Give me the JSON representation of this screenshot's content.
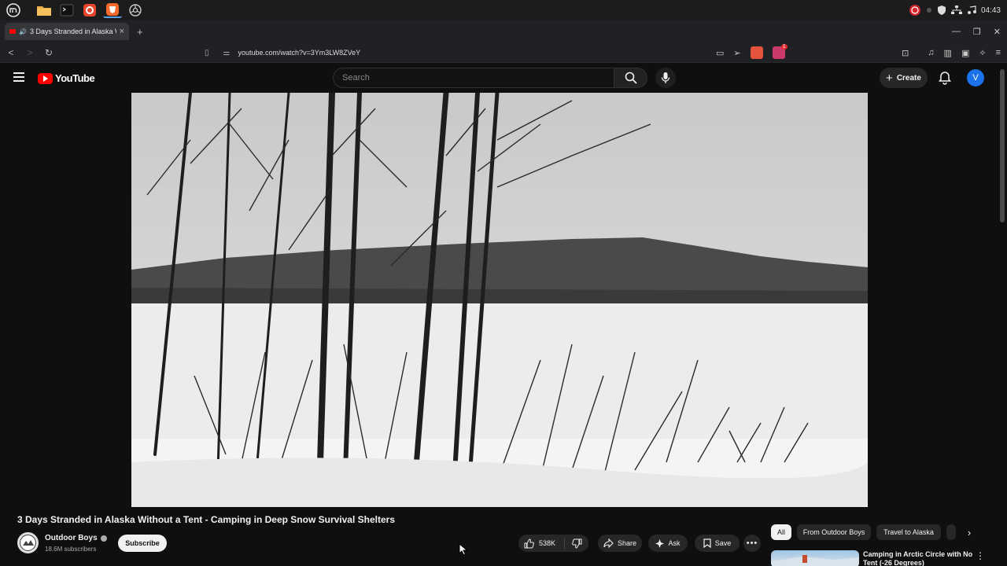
{
  "taskbar": {
    "apps": [
      "mint-menu-icon",
      "files-icon",
      "terminal-icon",
      "firefox-icon",
      "brave-icon",
      "chromium-icon"
    ],
    "clock": "04:43"
  },
  "browser": {
    "tab_title": "3 Days Stranded in Alaska W",
    "url": "youtube.com/watch?v=3Ym3LW8ZVeY",
    "extension_badge": "1"
  },
  "youtube": {
    "logo_text": "YouTube",
    "search_placeholder": "Search",
    "create_label": "Create",
    "avatar_letter": "V"
  },
  "video": {
    "title": "3 Days Stranded in Alaska Without a Tent - Camping in Deep Snow Survival Shelters",
    "channel": "Outdoor Boys",
    "subscribers": "18.6M subscribers",
    "subscribe_label": "Subscribe",
    "likes": "538K",
    "share_label": "Share",
    "ask_label": "Ask",
    "save_label": "Save"
  },
  "chips": [
    "All",
    "From Outdoor Boys",
    "Travel to Alaska"
  ],
  "recommendation": {
    "title": "Camping in Arctic Circle with No Tent (-26 Degrees)"
  },
  "colors": {
    "background": "#0f0f0f",
    "yt_red": "#ff0000",
    "surface": "#272727",
    "avatar": "#1a73e8"
  }
}
